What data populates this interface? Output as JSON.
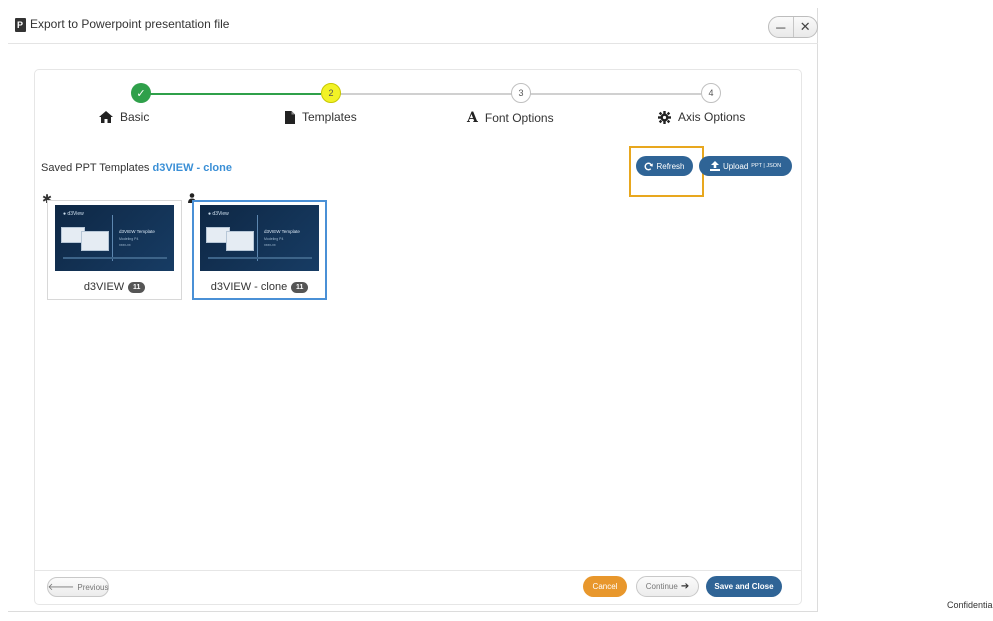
{
  "window": {
    "title": "Export to Powerpoint presentation file",
    "icon_letter": "P",
    "minimize_glyph": "─",
    "close_glyph": "✕"
  },
  "steps": [
    {
      "label": "Basic",
      "number": "✓",
      "state": "complete",
      "icon": "home-icon"
    },
    {
      "label": "Templates",
      "number": "2",
      "state": "current",
      "icon": "file-icon"
    },
    {
      "label": "Font Options",
      "number": "3",
      "state": "pending",
      "icon": "font-icon"
    },
    {
      "label": "Axis Options",
      "number": "4",
      "state": "pending",
      "icon": "gear-icon"
    }
  ],
  "templates_section": {
    "saved_label": "Saved PPT Templates",
    "active_template": "d3VIEW - clone",
    "refresh_label": "Refresh",
    "upload_label": "Upload",
    "upload_formats": "PPT | JSON"
  },
  "templates": [
    {
      "name": "d3VIEW",
      "count": "11",
      "marker": "✱",
      "selected": false,
      "marker_icon": "asterisk-icon"
    },
    {
      "name": "d3VIEW - clone",
      "count": "11",
      "marker": "user",
      "selected": true,
      "marker_icon": "user-icon"
    }
  ],
  "thumbnail": {
    "logo": "● d3View",
    "heading": "d3VIEW Template",
    "line1": "Modeling P4",
    "line2": "xxxx-xx"
  },
  "footer": {
    "previous_label": "Previous",
    "cancel_label": "Cancel",
    "continue_label": "Continue",
    "save_label": "Save and Close"
  },
  "watermark": "Confidential",
  "colors": {
    "complete": "#2fa04a",
    "current": "#f2f226",
    "primary": "#2f6496",
    "cancel": "#e8972c",
    "highlight": "#e8a71e",
    "link": "#3a8fd6"
  }
}
